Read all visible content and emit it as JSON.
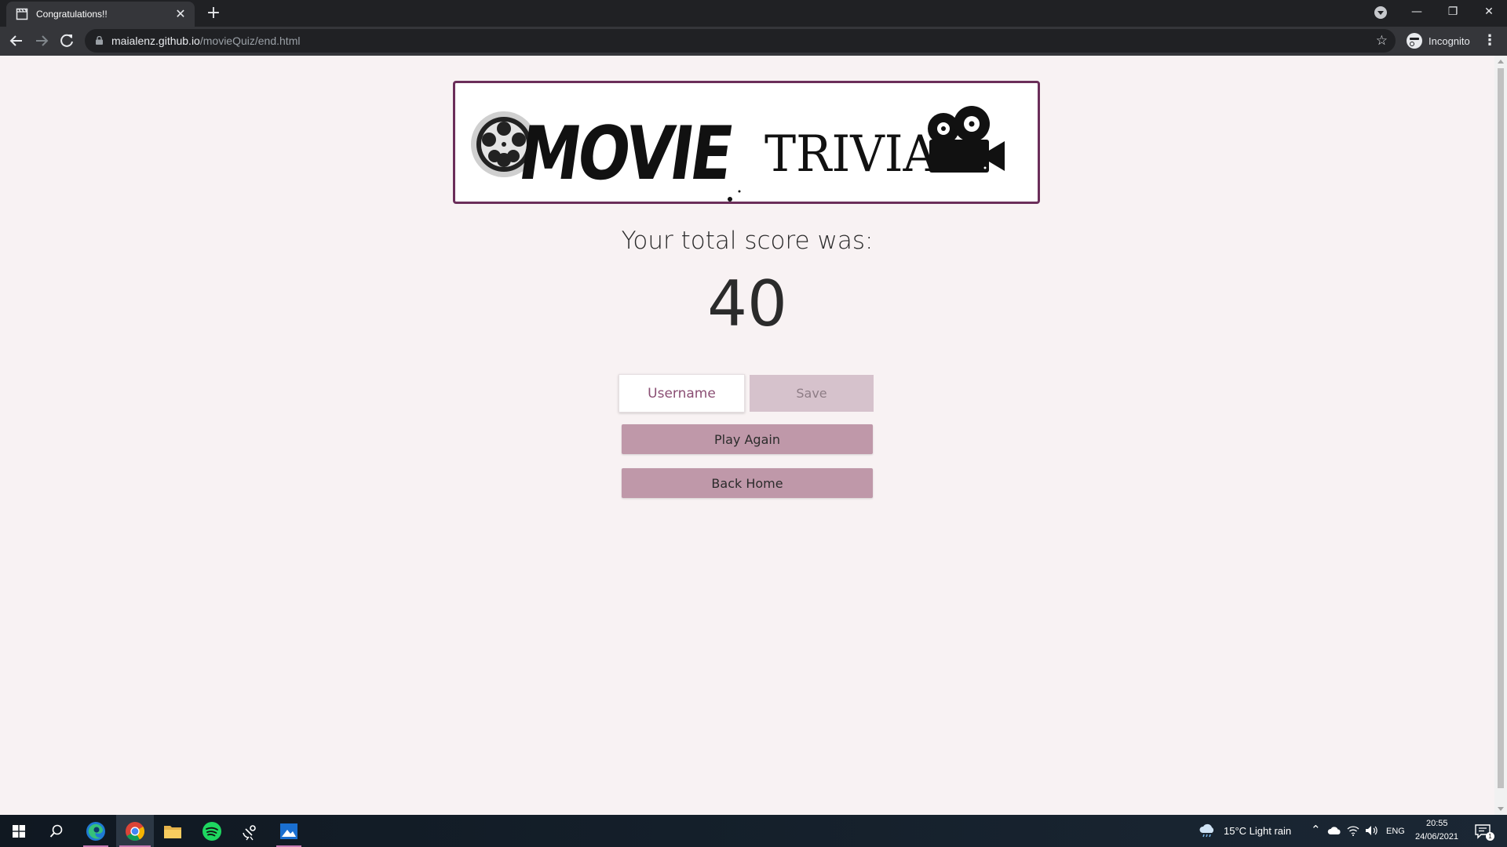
{
  "browser": {
    "tab_title": "Congratulations!!",
    "tab_close": "✕",
    "new_tab": "+",
    "url_host": "maialenz.github.io",
    "url_path": "/movieQuiz/end.html",
    "profile_label": "Incognito",
    "window_controls": [
      "—",
      "❐",
      "✕"
    ]
  },
  "page": {
    "logo_text": "MOVIE TRIVIA",
    "score_label": "Your total score was:",
    "score_value": "40",
    "username_placeholder": "Username",
    "save_label": "Save",
    "play_again_label": "Play Again",
    "back_home_label": "Back Home"
  },
  "taskbar": {
    "weather": "15°C  Light rain",
    "language": "ENG",
    "time": "20:55",
    "date": "24/06/2021",
    "notification_count": "1"
  },
  "colors": {
    "page_bg": "#f8f2f3",
    "logo_border": "#6b2e5a",
    "button_bg": "#bf98a9",
    "save_bg": "#d6c2cc",
    "placeholder": "#8a4e73"
  },
  "icons": [
    "tab-favicon-icon",
    "close-icon",
    "plus-icon",
    "back-arrow-icon",
    "forward-arrow-icon",
    "reload-icon",
    "lock-icon",
    "star-icon",
    "incognito-icon",
    "menu-icon",
    "film-reel-icon",
    "movie-camera-icon",
    "windows-start-icon",
    "search-icon",
    "edge-icon",
    "chrome-icon",
    "file-explorer-icon",
    "spotify-icon",
    "satellite-icon",
    "photos-icon",
    "cloud-rain-icon",
    "chevron-up-icon",
    "onedrive-icon",
    "wifi-icon",
    "volume-icon",
    "notification-icon"
  ]
}
